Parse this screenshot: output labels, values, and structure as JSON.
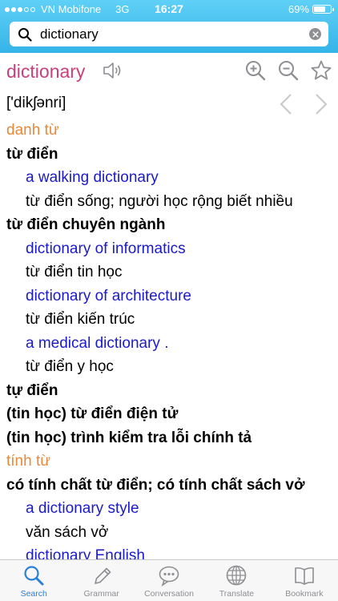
{
  "status_bar": {
    "carrier": "VN Mobifone",
    "network": "3G",
    "time": "16:27",
    "battery_percent": "69%",
    "battery_level": 0.69
  },
  "search": {
    "value": "dictionary",
    "placeholder": ""
  },
  "entry": {
    "headword": "dictionary",
    "pronunciation": "['dikʃənri]",
    "lines": [
      {
        "type": "pos",
        "text": "danh từ"
      },
      {
        "type": "sense",
        "text": "từ điển"
      },
      {
        "type": "example",
        "text": "a walking dictionary"
      },
      {
        "type": "trans",
        "text": "từ điển sống; người học rộng biết nhiều"
      },
      {
        "type": "sense",
        "text": "từ điển chuyên ngành"
      },
      {
        "type": "example",
        "text": "dictionary of informatics"
      },
      {
        "type": "trans",
        "text": "từ điển tin học"
      },
      {
        "type": "example",
        "text": "dictionary of architecture"
      },
      {
        "type": "trans",
        "text": "từ điển kiến trúc"
      },
      {
        "type": "example",
        "text": "a medical dictionary ."
      },
      {
        "type": "trans",
        "text": "từ điển y học"
      },
      {
        "type": "sense",
        "text": "tự điển"
      },
      {
        "type": "sense",
        "text": "(tin học) từ điển điện tử"
      },
      {
        "type": "sense",
        "text": "(tin học) trình kiểm tra lỗi chính tả"
      },
      {
        "type": "pos",
        "text": "tính từ"
      },
      {
        "type": "sense",
        "text": "có tính chất từ điển; có tính chất sách vở"
      },
      {
        "type": "example",
        "text": "a dictionary style"
      },
      {
        "type": "trans",
        "text": "văn sách vở"
      },
      {
        "type": "example",
        "text": "dictionary English"
      }
    ]
  },
  "tabs": [
    {
      "label": "Search",
      "icon": "search-icon",
      "active": true
    },
    {
      "label": "Grammar",
      "icon": "pencil-icon",
      "active": false
    },
    {
      "label": "Conversation",
      "icon": "chat-bubble-icon",
      "active": false
    },
    {
      "label": "Translate",
      "icon": "globe-icon",
      "active": false
    },
    {
      "label": "Bookmark",
      "icon": "book-icon",
      "active": false
    }
  ],
  "colors": {
    "header": "#35b4e8",
    "headword": "#c8407e",
    "part_of_speech": "#e8893a",
    "example": "#1a1ac8",
    "tab_active": "#2a7fd8",
    "tab_inactive": "#8e8e93"
  }
}
